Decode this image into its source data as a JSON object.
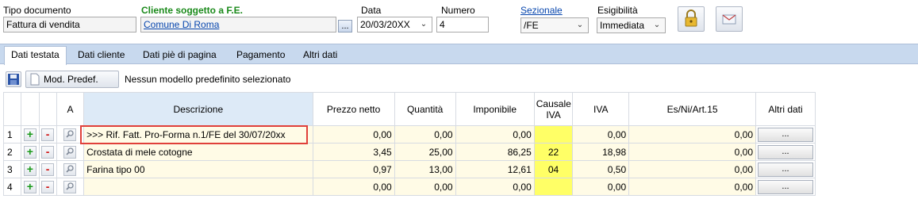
{
  "header": {
    "tipo_documento": {
      "label": "Tipo documento",
      "value": "Fattura di vendita"
    },
    "cliente": {
      "label": "Cliente soggetto a F.E.",
      "value": "Comune Di Roma",
      "browse_label": "..."
    },
    "data": {
      "label": "Data",
      "value": "20/03/20XX"
    },
    "numero": {
      "label": "Numero",
      "value": "4"
    },
    "sezionale": {
      "label": "Sezionale",
      "value": "/FE"
    },
    "esigibilita": {
      "label": "Esigibilità",
      "value": "Immediata"
    }
  },
  "tabs": [
    {
      "label": "Dati testata",
      "active": true
    },
    {
      "label": "Dati cliente"
    },
    {
      "label": "Dati piè di pagina"
    },
    {
      "label": "Pagamento"
    },
    {
      "label": "Altri dati"
    }
  ],
  "toolbar": {
    "mod_predef_label": "Mod. Predef.",
    "status_text": "Nessun modello predefinito selezionato"
  },
  "grid": {
    "columns": [
      "",
      "",
      "",
      "A",
      "Descrizione",
      "Prezzo netto",
      "Quantità",
      "Imponibile",
      "Causale IVA",
      "IVA",
      "Es/Ni/Art.15",
      "Altri dati"
    ],
    "rows": [
      {
        "n": "1",
        "descrizione": ">>> Rif. Fatt. Pro-Forma n.1/FE del 30/07/20xx",
        "prezzo": "0,00",
        "quantita": "0,00",
        "imponibile": "0,00",
        "causale": "",
        "iva": "0,00",
        "es": "0,00",
        "altri": "..."
      },
      {
        "n": "2",
        "descrizione": "Crostata di mele cotogne",
        "prezzo": "3,45",
        "quantita": "25,00",
        "imponibile": "86,25",
        "causale": "22",
        "iva": "18,98",
        "es": "0,00",
        "altri": "..."
      },
      {
        "n": "3",
        "descrizione": "Farina tipo 00",
        "prezzo": "0,97",
        "quantita": "13,00",
        "imponibile": "12,61",
        "causale": "04",
        "iva": "0,50",
        "es": "0,00",
        "altri": "..."
      },
      {
        "n": "4",
        "descrizione": "",
        "prezzo": "0,00",
        "quantita": "0,00",
        "imponibile": "0,00",
        "causale": "",
        "iva": "0,00",
        "es": "0,00",
        "altri": "..."
      }
    ],
    "plus": "+",
    "minus": "-"
  },
  "colors": {
    "cliente_label": "#1b8a1b",
    "link": "#0645ad",
    "causale_iva_bg": "#ffff66",
    "row_bg": "#fffbe6",
    "tab_bar": "#c8d9ee",
    "highlight": "#e0403a"
  }
}
